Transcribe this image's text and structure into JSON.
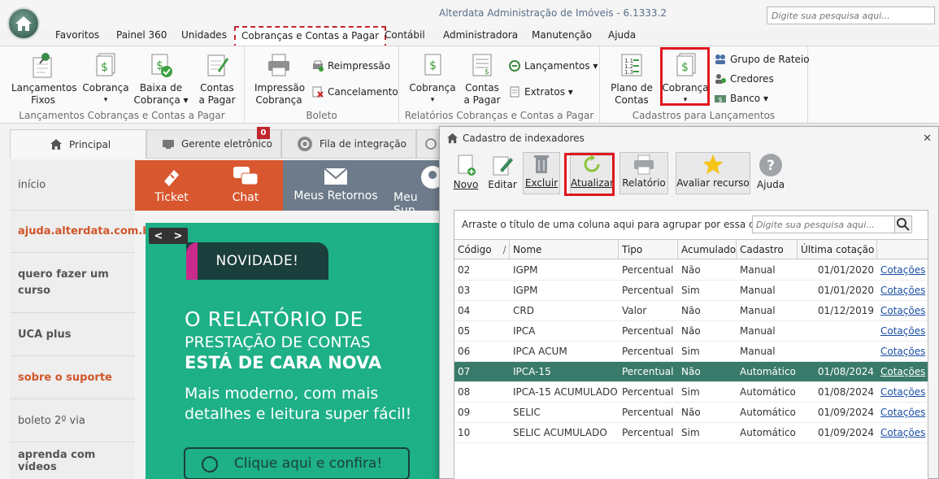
{
  "window": {
    "title": "Alterdata Administração de Imóveis - 6.1333.2",
    "search_placeholder": "Digite sua pesquisa aqui..."
  },
  "menu": {
    "tabs": [
      "Favoritos",
      "Painel 360",
      "Unidades",
      "Cobranças e Contas a Pagar",
      "Contábil",
      "Administradora",
      "Manutenção",
      "Ajuda"
    ],
    "active_index": 3
  },
  "ribbon": {
    "group1": {
      "label": "Lançamentos Cobranças e Contas a Pagar",
      "buttons": [
        {
          "line1": "Lançamentos",
          "line2": "Fixos"
        },
        {
          "line1": "Cobrança",
          "line2": "▾"
        },
        {
          "line1": "Baixa de",
          "line2": "Cobrança ▾"
        },
        {
          "line1": "Contas",
          "line2": "a Pagar"
        }
      ]
    },
    "group2": {
      "label": "Boleto",
      "big": {
        "line1": "Impressão",
        "line2": "Cobrança"
      },
      "small": [
        "Reimpressão",
        "Cancelamento"
      ]
    },
    "group3": {
      "label": "Relatórios Cobranças e Contas a Pagar",
      "buttons": [
        {
          "line1": "Cobrança",
          "line2": "▾"
        },
        {
          "line1": "Contas",
          "line2": "a Pagar"
        }
      ],
      "small": [
        "Lançamentos ▾",
        "Extratos ▾"
      ]
    },
    "group4": {
      "label": "Cadastros para Lançamentos",
      "buttons": [
        {
          "line1": "Plano de",
          "line2": "Contas"
        },
        {
          "line1": "Cobrança",
          "line2": "▾"
        }
      ],
      "small": [
        "Grupo de Rateio",
        "Credores",
        "Banco ▾"
      ]
    }
  },
  "doc_tabs": {
    "principal": "Principal",
    "gerente": "Gerente eletrônico",
    "fila": "Fila de integração",
    "badge": "0"
  },
  "side_nav": {
    "items": [
      "início",
      "ajuda.alterdata.com.br",
      "quero fazer um curso",
      "UCA plus",
      "sobre o suporte",
      "boleto 2º via",
      "aprenda com vídeos"
    ]
  },
  "quick_bar": {
    "ticket": "Ticket",
    "chat": "Chat",
    "retornos": "Meus Retornos",
    "suporte": "Meu Sup"
  },
  "banner": {
    "tag": "NOVIDADE!",
    "line1": "O RELATÓRIO DE",
    "line2": "PRESTAÇÃO DE CONTAS",
    "line3": "ESTÁ DE CARA NOVA",
    "line4": "Mais moderno, com mais",
    "line5": "detalhes e leitura super fácil!",
    "cta": "Clique aqui e confira!",
    "prev": "<",
    "next": ">"
  },
  "dialog": {
    "title": "Cadastro de indexadores",
    "close": "✕",
    "toolbar": [
      "Novo",
      "Editar",
      "Excluir",
      "Atualizar",
      "Relatório",
      "Avaliar recurso",
      "Ajuda"
    ],
    "group_hint": "Arraste o título de uma coluna aqui para agrupar por essa coluna",
    "search_placeholder": "Digite sua pesquisa aqui...",
    "columns": [
      "Código",
      "Nome",
      "Tipo",
      "Acumulado",
      "Cadastro",
      "Última cotação",
      ""
    ],
    "rows": [
      {
        "codigo": "02",
        "nome": "IGPM",
        "tipo": "Percentual",
        "acumulado": "Não",
        "cadastro": "Manual",
        "cotacao": "01/01/2020",
        "link": "Cotações"
      },
      {
        "codigo": "03",
        "nome": "IGPM",
        "tipo": "Percentual",
        "acumulado": "Sim",
        "cadastro": "Manual",
        "cotacao": "01/01/2020",
        "link": "Cotações"
      },
      {
        "codigo": "04",
        "nome": "CRD",
        "tipo": "Valor",
        "acumulado": "Não",
        "cadastro": "Manual",
        "cotacao": "01/12/2019",
        "link": "Cotações"
      },
      {
        "codigo": "05",
        "nome": "IPCA",
        "tipo": "Percentual",
        "acumulado": "Não",
        "cadastro": "Manual",
        "cotacao": "",
        "link": "Cotações"
      },
      {
        "codigo": "06",
        "nome": "IPCA ACUM",
        "tipo": "Percentual",
        "acumulado": "Sim",
        "cadastro": "Manual",
        "cotacao": "",
        "link": "Cotações"
      },
      {
        "codigo": "07",
        "nome": "IPCA-15",
        "tipo": "Percentual",
        "acumulado": "Não",
        "cadastro": "Automático",
        "cotacao": "01/08/2024",
        "link": "Cotações"
      },
      {
        "codigo": "08",
        "nome": "IPCA-15 ACUMULADO",
        "tipo": "Percentual",
        "acumulado": "Sim",
        "cadastro": "Automático",
        "cotacao": "01/08/2024",
        "link": "Cotações"
      },
      {
        "codigo": "09",
        "nome": "SELIC",
        "tipo": "Percentual",
        "acumulado": "Não",
        "cadastro": "Automático",
        "cotacao": "01/09/2024",
        "link": "Cotações"
      },
      {
        "codigo": "10",
        "nome": "SELIC ACUMULADO",
        "tipo": "Percentual",
        "acumulado": "Sim",
        "cadastro": "Automático",
        "cotacao": "01/09/2024",
        "link": "Cotações"
      }
    ],
    "selected_row": 5,
    "sort_indicator": "/"
  },
  "colors": {
    "accent_red": "#e0161e",
    "selected_row": "#3a7a6a",
    "banner_green": "#1eb087",
    "orange": "#d9572f"
  }
}
